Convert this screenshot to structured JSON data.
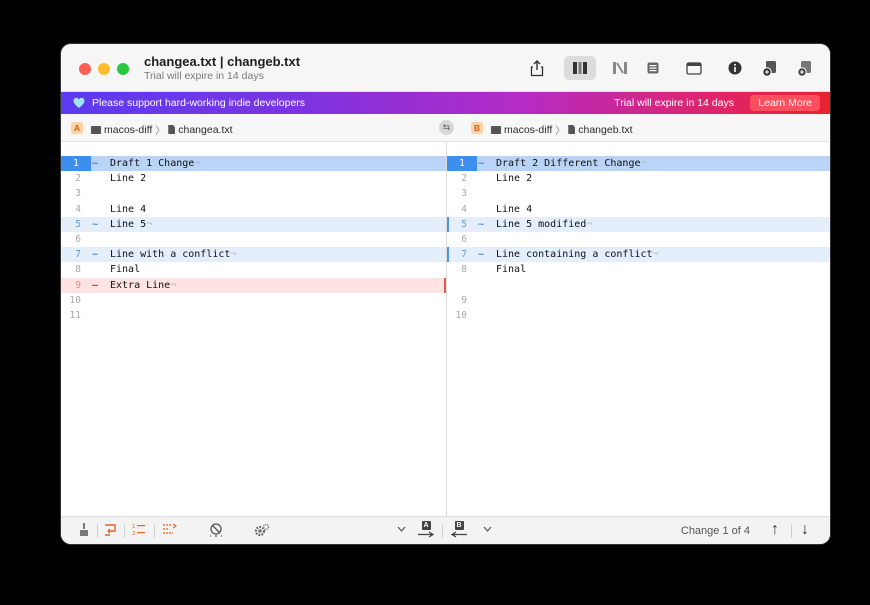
{
  "window": {
    "title": "changea.txt | changeb.txt",
    "subtitle": "Trial will expire in 14 days"
  },
  "toolbar": {
    "buttons": [
      "share-icon",
      "side-by-side-view-icon",
      "merge-view-icon",
      "unified-view-icon",
      "window-icon",
      "info-icon",
      "save-left-icon",
      "save-right-icon"
    ]
  },
  "banner": {
    "support_text": "Please support hard-working indie developers",
    "trial_text": "Trial will expire in 14 days",
    "learn_more": "Learn More",
    "gradient": [
      "#5b3bf0",
      "#e8232f"
    ]
  },
  "paths": {
    "left": {
      "badge": "A",
      "folder": "macos-diff",
      "file": "changea.txt"
    },
    "right": {
      "badge": "B",
      "folder": "macos-diff",
      "file": "changeb.txt"
    },
    "separator": "〉"
  },
  "left_pane": {
    "lines": [
      {
        "num": "1",
        "mark": "~",
        "state": "selected",
        "code": "Draft 1 Change",
        "eol": "¬"
      },
      {
        "num": "2",
        "mark": "",
        "state": "normal",
        "code": "Line 2",
        "eol": ""
      },
      {
        "num": "3",
        "mark": "",
        "state": "normal",
        "code": "",
        "eol": ""
      },
      {
        "num": "4",
        "mark": "",
        "state": "normal",
        "code": "Line 4",
        "eol": ""
      },
      {
        "num": "5",
        "mark": "~",
        "state": "changed",
        "code": "Line 5",
        "eol": "¬"
      },
      {
        "num": "6",
        "mark": "",
        "state": "normal",
        "code": "",
        "eol": ""
      },
      {
        "num": "7",
        "mark": "~",
        "state": "changed",
        "code": "Line with a conflict",
        "eol": "¬"
      },
      {
        "num": "8",
        "mark": "",
        "state": "normal",
        "code": "Final",
        "eol": ""
      },
      {
        "num": "9",
        "mark": "—",
        "state": "deleted",
        "code": "Extra Line",
        "eol": "¬"
      },
      {
        "num": "10",
        "mark": "",
        "state": "normal",
        "code": "",
        "eol": ""
      },
      {
        "num": "11",
        "mark": "",
        "state": "normal",
        "code": "",
        "eol": ""
      }
    ]
  },
  "right_pane": {
    "lines": [
      {
        "num": "1",
        "mark": "~",
        "state": "selected",
        "code": "Draft 2 Different Change",
        "eol": "¬"
      },
      {
        "num": "2",
        "mark": "",
        "state": "normal",
        "code": "Line 2",
        "eol": ""
      },
      {
        "num": "3",
        "mark": "",
        "state": "normal",
        "code": "",
        "eol": ""
      },
      {
        "num": "4",
        "mark": "",
        "state": "normal",
        "code": "Line 4",
        "eol": ""
      },
      {
        "num": "5",
        "mark": "~",
        "state": "changed",
        "code": "Line 5 modified",
        "eol": "¬"
      },
      {
        "num": "6",
        "mark": "",
        "state": "normal",
        "code": "",
        "eol": ""
      },
      {
        "num": "7",
        "mark": "~",
        "state": "changed",
        "code": "Line containing a conflict",
        "eol": "¬"
      },
      {
        "num": "8",
        "mark": "",
        "state": "normal",
        "code": "Final",
        "eol": ""
      },
      {
        "num": "",
        "mark": "",
        "state": "blank",
        "code": "",
        "eol": ""
      },
      {
        "num": "9",
        "mark": "",
        "state": "normal",
        "code": "",
        "eol": ""
      },
      {
        "num": "10",
        "mark": "",
        "state": "normal",
        "code": "",
        "eol": ""
      }
    ]
  },
  "bottombar": {
    "change_status": "Change 1 of 4",
    "copy_left_badge": "A",
    "copy_right_badge": "B"
  },
  "colors": {
    "selected_line": "#b9d4f6",
    "changed_line": "#e4effb",
    "deleted_line": "#fde3e2",
    "accent": "#3e8ef0"
  }
}
